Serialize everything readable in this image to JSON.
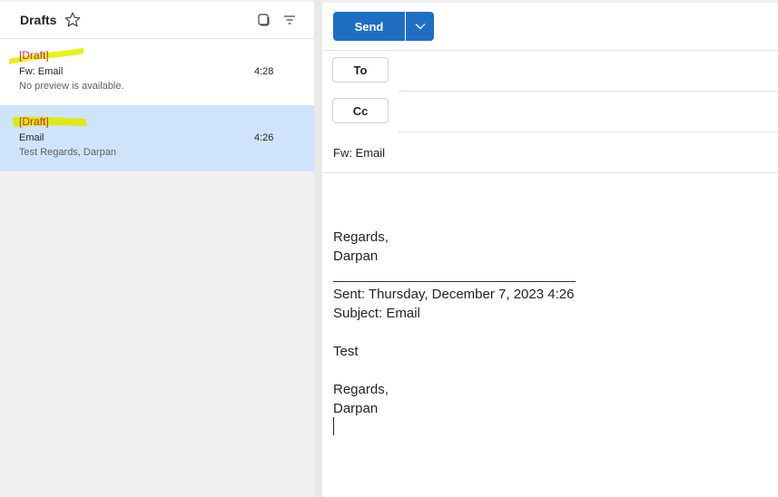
{
  "folder": {
    "title": "Drafts"
  },
  "messages": [
    {
      "tag": "[Draft]",
      "subject": "Fw: Email",
      "time": "4:28",
      "preview": "No preview is available."
    },
    {
      "tag": "[Draft]",
      "subject": "Email",
      "time": "4:26",
      "preview": "Test Regards, Darpan"
    }
  ],
  "compose": {
    "send_label": "Send",
    "to_label": "To",
    "cc_label": "Cc",
    "subject": "Fw: Email",
    "body": {
      "regards": "Regards,",
      "name": "Darpan",
      "separator": "________________________________",
      "sent": "Sent: Thursday, December 7, 2023 4:26",
      "subject_line": "Subject: Email",
      "text": "Test",
      "regards2": "Regards,",
      "name2": "Darpan"
    }
  },
  "colors": {
    "accent": "#1f6ec4",
    "selected_row": "#cfe4fa",
    "draft_tag": "#c4314b",
    "highlighter": "#e5ef00"
  },
  "icons": [
    "star-icon",
    "select-icon",
    "filter-icon",
    "chevron-down-icon"
  ]
}
